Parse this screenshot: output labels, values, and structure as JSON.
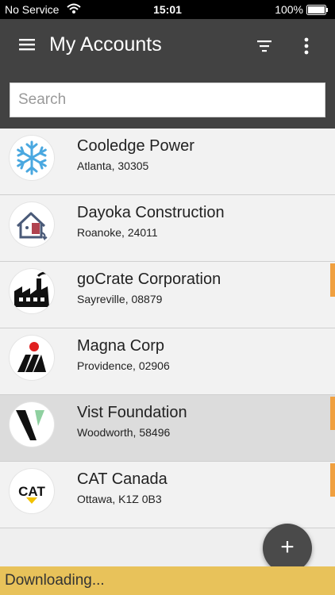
{
  "status_bar": {
    "carrier": "No Service",
    "time": "15:01",
    "battery": "100%"
  },
  "header": {
    "title": "My Accounts",
    "icons": [
      "menu-icon",
      "filter-icon",
      "more-vert-icon"
    ]
  },
  "search": {
    "placeholder": "Search",
    "value": ""
  },
  "accounts": [
    {
      "name": "Cooledge Power",
      "address": "Atlanta, 30305",
      "logo": "snowflake-logo",
      "flagged": false,
      "selected": false
    },
    {
      "name": "Dayoka Construction",
      "address": "Roanoke, 24011",
      "logo": "house-logo",
      "flagged": false,
      "selected": false
    },
    {
      "name": "goCrate Corporation",
      "address": "Sayreville, 08879",
      "logo": "factory-logo",
      "flagged": true,
      "selected": false
    },
    {
      "name": "Magna Corp",
      "address": "Providence, 02906",
      "logo": "magna-logo",
      "flagged": false,
      "selected": false
    },
    {
      "name": "Vist Foundation",
      "address": "Woodworth, 58496",
      "logo": "v-logo",
      "flagged": true,
      "selected": true
    },
    {
      "name": "CAT Canada",
      "address": "Ottawa, K1Z 0B3",
      "logo": "cat-logo",
      "flagged": true,
      "selected": false
    }
  ],
  "logo_text": {
    "cat": "CAT"
  },
  "fab": {
    "label": "+"
  },
  "bottom_bar": {
    "text": "Downloading..."
  },
  "colors": {
    "app_bar": "#424242",
    "flag": "#f0a040",
    "bottom_bar": "#e8c25a",
    "fab": "#4a4a4a",
    "selected_row": "#dcdcdc"
  }
}
